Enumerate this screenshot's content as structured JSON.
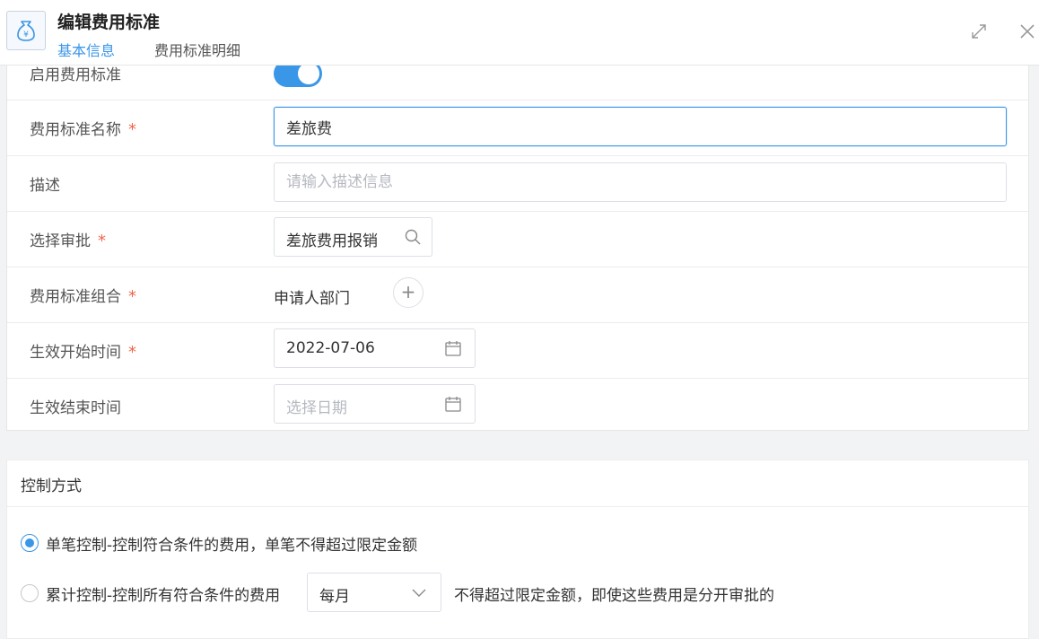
{
  "header": {
    "title": "编辑费用标准",
    "tabs": [
      {
        "label": "基本信息",
        "active": true
      },
      {
        "label": "费用标准明细",
        "active": false
      }
    ],
    "logo_icon": "money-bag-icon",
    "expand_icon": "expand-icon",
    "close_icon": "close-icon"
  },
  "form": {
    "enable": {
      "label": "启用费用标准",
      "value": true
    },
    "name": {
      "label": "费用标准名称",
      "required_mark": "*",
      "value": "差旅费"
    },
    "description": {
      "label": "描述",
      "placeholder": "请输入描述信息",
      "value": ""
    },
    "approval": {
      "label": "选择审批",
      "required_mark": "*",
      "value": "差旅费用报销",
      "icon": "search-icon"
    },
    "combination": {
      "label": "费用标准组合",
      "required_mark": "*",
      "value": "申请人部门",
      "add_symbol": "+"
    },
    "start_date": {
      "label": "生效开始时间",
      "required_mark": "*",
      "value": "2022-07-06",
      "icon": "calendar-icon"
    },
    "end_date": {
      "label": "生效结束时间",
      "placeholder": "选择日期",
      "icon": "calendar-icon"
    }
  },
  "control": {
    "title": "控制方式",
    "options": [
      {
        "label": "单笔控制-控制符合条件的费用，单笔不得超过限定金额",
        "selected": true
      },
      {
        "label": "累计控制-控制所有符合条件的费用",
        "selected": false
      }
    ],
    "period_select": {
      "value": "每月",
      "icon": "chevron-down-icon"
    },
    "period_suffix": "不得超过限定金额，即使这些费用是分开审批的"
  },
  "colors": {
    "accent": "#3a96e7",
    "required": "#f0654a",
    "border": "#dcdfe6"
  }
}
